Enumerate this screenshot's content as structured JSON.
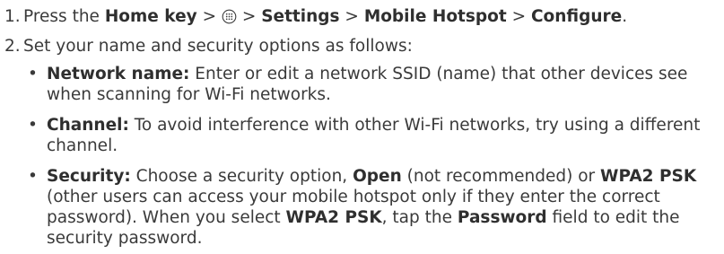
{
  "steps": [
    {
      "num": "1.",
      "t1": "Press the ",
      "b1": "Home key",
      "t2": " > ",
      "t3": " > ",
      "b2": "Settings",
      "t4": " > ",
      "b3": "Mobile Hotspot",
      "t5": " > ",
      "b4": "Configure",
      "t6": "."
    },
    {
      "num": "2.",
      "text": "Set your name and security options as follows:"
    }
  ],
  "bullets": [
    {
      "dot": "•",
      "label": "Network name:",
      "text": " Enter or edit a network SSID (name) that other devices see when scanning for Wi-Fi networks."
    },
    {
      "dot": "•",
      "label": "Channel:",
      "text": " To avoid interference with other Wi-Fi networks, try using a different channel."
    },
    {
      "dot": "•",
      "label": "Security:",
      "t1": " Choose a security option, ",
      "b1": "Open",
      "t2": " (not recommended) or ",
      "b2": "WPA2 PSK",
      "t3": " (other users can access your mobile hotspot only if they enter the correct password). When you select ",
      "b3": "WPA2 PSK",
      "t4": ", tap the ",
      "b4": "Password",
      "t5": " field to edit the security password."
    }
  ],
  "icons": {
    "apps": "apps-icon"
  },
  "colors": {
    "text": "#3a3a3a"
  }
}
